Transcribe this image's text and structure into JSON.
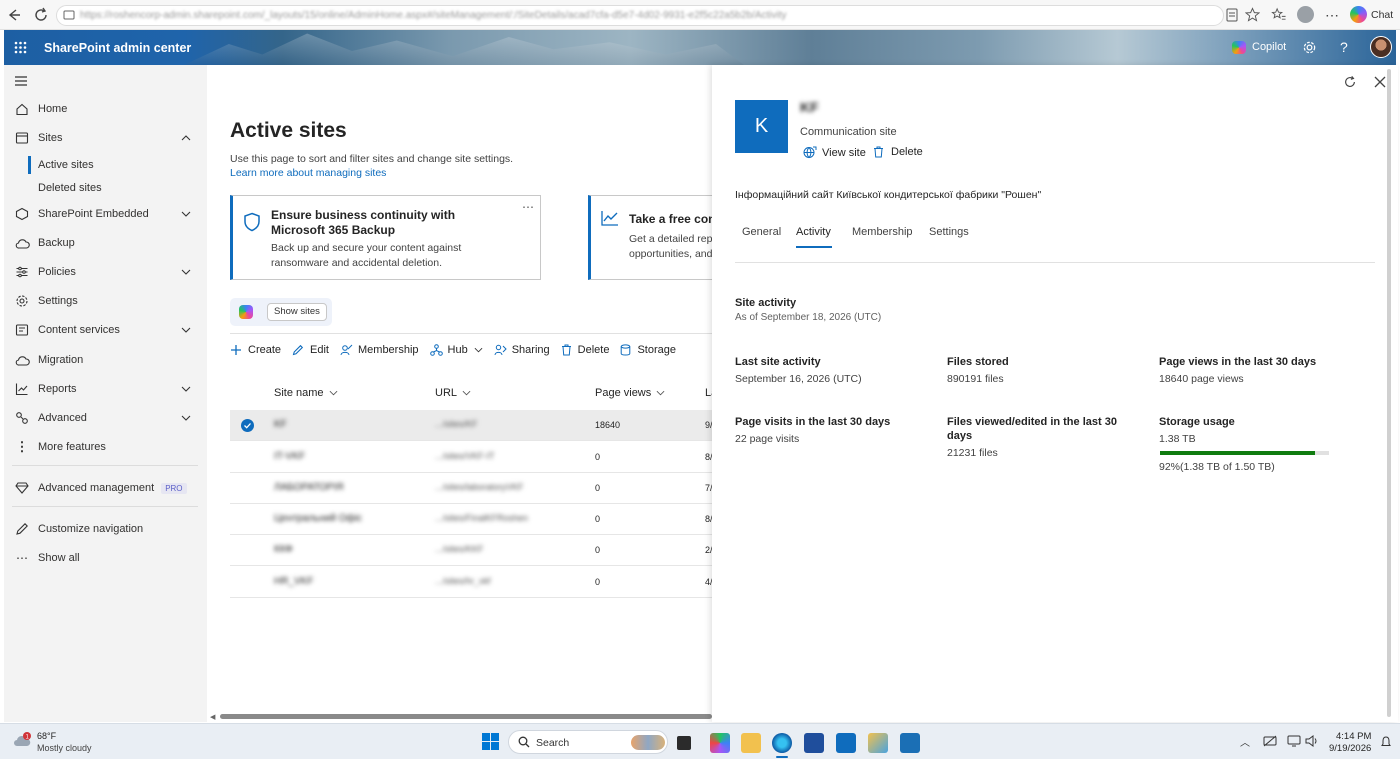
{
  "browser": {
    "url": "https://roshencorp-admin.sharepoint.com/_layouts/15/online/AdminHome.aspx#/siteManagement/:/SiteDetails/acad7cfa-d5e7-4d02-9931-e2f5c22a5b2b/Activity",
    "chat_label": "Chat"
  },
  "suite": {
    "app_title": "SharePoint admin center",
    "copilot_label": "Copilot"
  },
  "nav": {
    "home": "Home",
    "sites": "Sites",
    "active_sites": "Active sites",
    "deleted_sites": "Deleted sites",
    "sp_embedded": "SharePoint Embedded",
    "backup": "Backup",
    "policies": "Policies",
    "settings": "Settings",
    "content_services": "Content services",
    "migration": "Migration",
    "reports": "Reports",
    "advanced": "Advanced",
    "more_features": "More features",
    "advanced_management": "Advanced management",
    "pro_badge": "PRO",
    "customize_navigation": "Customize navigation",
    "show_all": "Show all"
  },
  "main": {
    "title": "Active sites",
    "description": "Use this page to sort and filter sites and change site settings.",
    "learn_more": "Learn more about managing sites",
    "card1_title": "Ensure business continuity with Microsoft 365 Backup",
    "card1_desc": "Back up and secure your content against ransomware and accidental deletion.",
    "card2_title": "Take a free con",
    "card2_desc_1": "Get a detailed repo",
    "card2_desc_2": "opportunities, and",
    "show_sites": "Show sites",
    "toolbar": {
      "create": "Create",
      "edit": "Edit",
      "membership": "Membership",
      "hub": "Hub",
      "sharing": "Sharing",
      "delete": "Delete",
      "storage": "Storage"
    },
    "columns": {
      "site_name": "Site name",
      "url": "URL",
      "page_views": "Page views",
      "last": "La"
    },
    "rows": [
      {
        "name": "KF",
        "url": ".../sites/KF",
        "views": "18640",
        "last": "9/"
      },
      {
        "name": "IT-VKF",
        "url": ".../sites/VKF-IT",
        "views": "0",
        "last": "8/"
      },
      {
        "name": "ЛАБОРАТОРІЯ",
        "url": ".../sites/laboratoryVKF",
        "views": "0",
        "last": "7/"
      },
      {
        "name": "Центральний Офіс",
        "url": ".../sites/FinalKFRoshen",
        "views": "0",
        "last": "8/"
      },
      {
        "name": "ККФ",
        "url": ".../sites/KKF",
        "views": "0",
        "last": "2/"
      },
      {
        "name": "HR_VKF",
        "url": ".../sites/hr_vkf",
        "views": "0",
        "last": "4/"
      }
    ]
  },
  "panel": {
    "avatar_letter": "K",
    "site_title": "KF",
    "site_type": "Communication site",
    "view_site": "View site",
    "delete": "Delete",
    "description": "Інформаційний сайт Київської кондитерської фабрики \"Рошен\"",
    "tabs": [
      "General",
      "Activity",
      "Membership",
      "Settings"
    ],
    "activity": {
      "heading": "Site activity",
      "as_of": "As of September 18, 2026 (UTC)",
      "last_site_activity_label": "Last site activity",
      "last_site_activity_value": "September 16, 2026 (UTC)",
      "files_stored_label": "Files stored",
      "files_stored_value": "890191 files",
      "page_views_label": "Page views in the last 30 days",
      "page_views_value": "18640 page views",
      "page_visits_label": "Page visits in the last 30 days",
      "page_visits_value": "22 page visits",
      "files_viewed_label_1": "Files viewed/edited in the last 30",
      "files_viewed_label_2": "days",
      "files_viewed_value": "21231 files",
      "storage_label": "Storage usage",
      "storage_value": "1.38 TB",
      "storage_percent": 0.92,
      "storage_detail": "92%(1.38 TB of 1.50 TB)"
    }
  },
  "taskbar": {
    "temperature": "68°F",
    "weather": "Mostly cloudy",
    "search": "Search",
    "time": "4:14 PM",
    "date": "9/19/2026"
  },
  "colors": {
    "accent": "#0f6cbd",
    "storage_bar": "#107c10",
    "nav_bg": "#f3f3f3"
  }
}
